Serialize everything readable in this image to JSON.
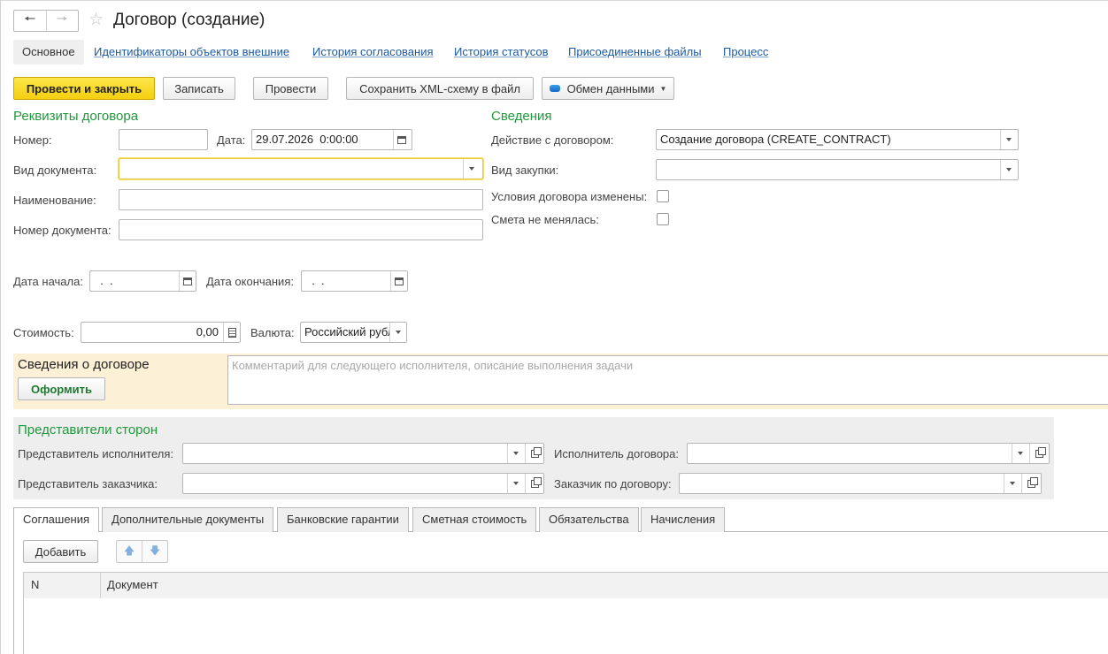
{
  "window": {
    "title": "Договор (создание)"
  },
  "top_tabs": [
    "Основное",
    "Идентификаторы объектов внешние",
    "История согласования",
    "История статусов",
    "Присоединенные файлы",
    "Процесс"
  ],
  "toolbar": {
    "post_close": "Провести и закрыть",
    "save": "Записать",
    "post": "Провести",
    "save_xml": "Сохранить XML-схему в файл",
    "exchange": "Обмен данными"
  },
  "contract_details": {
    "title": "Реквизиты договора",
    "number_label": "Номер:",
    "number_value": "",
    "date_label": "Дата:",
    "date_value": "29.07.2026  0:00:00",
    "doc_type_label": "Вид документа:",
    "doc_type_value": "",
    "name_label": "Наименование:",
    "name_value": "",
    "doc_number_label": "Номер документа:",
    "doc_number_value": "",
    "start_label": "Дата начала:",
    "start_value": "  .  .",
    "end_label": "Дата окончания:",
    "end_value": "  .  .",
    "cost_label": "Стоимость:",
    "cost_value": "0,00",
    "currency_label": "Валюта:",
    "currency_value": "Российский рубль"
  },
  "info": {
    "title": "Сведения",
    "action_label": "Действие с договором:",
    "action_value": "Создание договора (CREATE_CONTRACT)",
    "purchase_label": "Вид закупки:",
    "purchase_value": "",
    "changed_label": "Условия договора изменены:",
    "changed_checked": false,
    "estimate_label": "Смета не менялась:",
    "estimate_checked": false
  },
  "contract_info": {
    "title": "Сведения о договоре",
    "button": "Оформить",
    "comment_placeholder": "Комментарий для следующего исполнителя, описание выполнения задачи"
  },
  "reps": {
    "title": "Представители сторон",
    "exec_rep_label": "Представитель исполнителя:",
    "exec_rep_value": "",
    "contract_exec_label": "Исполнитель договора:",
    "contract_exec_value": "",
    "cust_rep_label": "Представитель заказчика:",
    "cust_rep_value": "",
    "cust_contract_label": "Заказчик по договору:",
    "cust_contract_value": ""
  },
  "bottom_tabs": [
    "Соглашения",
    "Дополнительные документы",
    "Банковские гарантии",
    "Сметная стоимость",
    "Обязательства",
    "Начисления"
  ],
  "agreements": {
    "add_button": "Добавить",
    "columns": [
      "N",
      "Документ"
    ],
    "rows": []
  },
  "colors": {
    "accent_green": "#22983c",
    "primary_yellow": "#f5cf0f",
    "link_blue": "#1c5aa3",
    "panel_beige": "#fcf0d6"
  }
}
